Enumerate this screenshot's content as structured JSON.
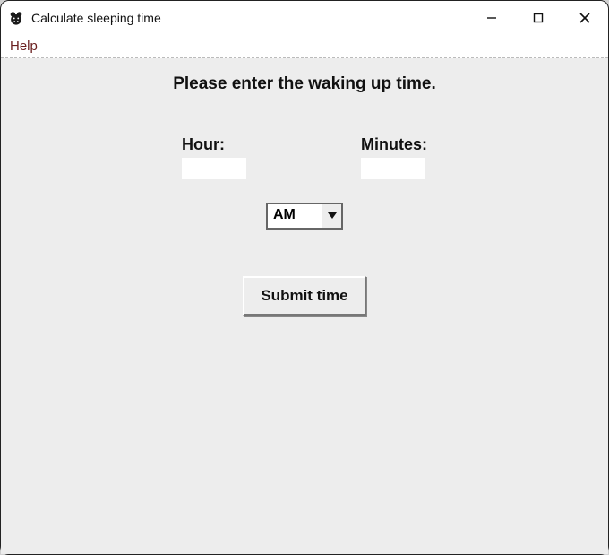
{
  "window": {
    "title": "Calculate sleeping time"
  },
  "menu": {
    "help": "Help"
  },
  "form": {
    "prompt": "Please enter the waking up time.",
    "hour_label": "Hour:",
    "hour_value": "",
    "minutes_label": "Minutes:",
    "minutes_value": "",
    "ampm_selected": "AM",
    "submit_label": "Submit time"
  }
}
